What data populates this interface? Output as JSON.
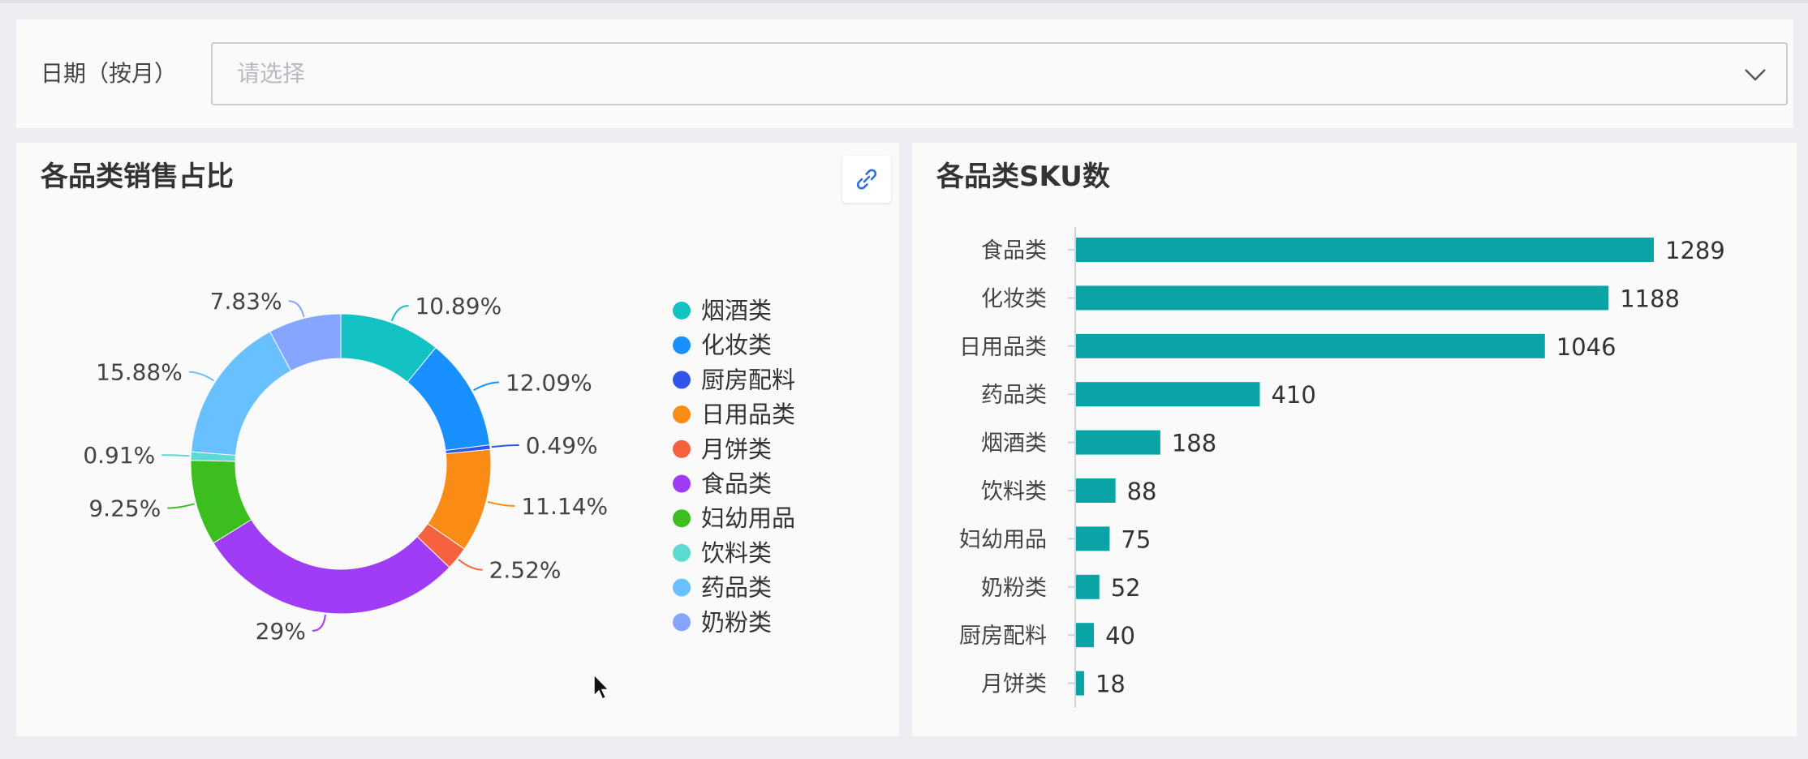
{
  "filter": {
    "label": "日期（按月）",
    "placeholder": "请选择"
  },
  "colors": {
    "bar": "#0aa3a6",
    "axis": "#d0d3d8",
    "text": "#333333",
    "label": "#444444"
  },
  "chart_data": [
    {
      "type": "pie",
      "title": "各品类销售占比",
      "donut": true,
      "legend_position": "right",
      "slices": [
        {
          "name": "烟酒类",
          "value": 10.89,
          "label": "10.89%",
          "color": "#13c2c2"
        },
        {
          "name": "化妆类",
          "value": 12.09,
          "label": "12.09%",
          "color": "#1890ff"
        },
        {
          "name": "厨房配料",
          "value": 0.49,
          "label": "0.49%",
          "color": "#2f54eb"
        },
        {
          "name": "日用品类",
          "value": 11.14,
          "label": "11.14%",
          "color": "#fa8c16"
        },
        {
          "name": "月饼类",
          "value": 2.52,
          "label": "2.52%",
          "color": "#f5623d"
        },
        {
          "name": "食品类",
          "value": 29,
          "label": "29%",
          "color": "#a03cf5"
        },
        {
          "name": "妇幼用品",
          "value": 9.25,
          "label": "9.25%",
          "color": "#3cbe1e"
        },
        {
          "name": "饮料类",
          "value": 0.91,
          "label": "0.91%",
          "color": "#5cdbd3"
        },
        {
          "name": "药品类",
          "value": 15.88,
          "label": "15.88%",
          "color": "#69c0ff"
        },
        {
          "name": "奶粉类",
          "value": 7.83,
          "label": "7.83%",
          "color": "#85a5ff"
        }
      ]
    },
    {
      "type": "bar",
      "orientation": "horizontal",
      "title": "各品类SKU数",
      "categories": [
        "食品类",
        "化妆类",
        "日用品类",
        "药品类",
        "烟酒类",
        "饮料类",
        "妇幼用品",
        "奶粉类",
        "厨房配料",
        "月饼类"
      ],
      "values": [
        1289,
        1188,
        1046,
        410,
        188,
        88,
        75,
        52,
        40,
        18
      ],
      "xlim": [
        0,
        1289
      ],
      "grid": false
    }
  ],
  "icons": {
    "link": "link-icon",
    "dropdown": "chevron-down-icon",
    "cursor": "mouse-cursor-icon"
  }
}
